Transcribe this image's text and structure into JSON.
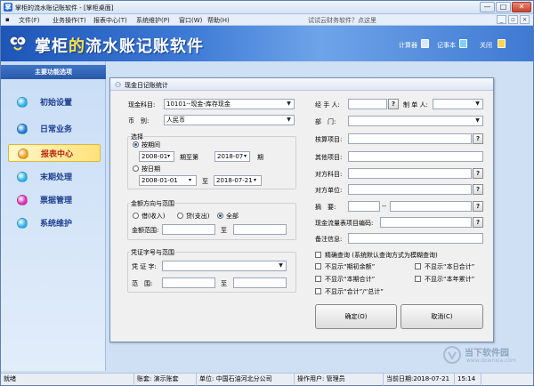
{
  "window": {
    "title": "掌柜的流水账记账软件 - [掌柜桌面]",
    "controls": [
      "—",
      "□",
      "✕"
    ]
  },
  "menu": {
    "items": [
      "文件(F)",
      "业务操作(T)",
      "报表中心(T)",
      "系统维护(P)",
      "窗口(W)",
      "帮助(H)"
    ],
    "promo": "试试云财务软件？点这里",
    "mdi_controls": [
      "_",
      "▫",
      "×"
    ]
  },
  "banner": {
    "logo_prefix": "掌柜",
    "logo_highlight": "的",
    "logo_suffix": "流水账记账软件",
    "tools": [
      "计算器",
      "记事本",
      "关闭"
    ]
  },
  "sidebar": {
    "title": "主要功能选项",
    "items": [
      {
        "label": "初始设置",
        "color": "#2bb1e8"
      },
      {
        "label": "日常业务",
        "color": "#1d7bd6"
      },
      {
        "label": "报表中心",
        "color": "#f4a01c"
      },
      {
        "label": "末期处理",
        "color": "#2bb1e8"
      },
      {
        "label": "票据管理",
        "color": "#d92fb0"
      },
      {
        "label": "系统维护",
        "color": "#2bb1e8"
      }
    ],
    "active_index": 2
  },
  "dialog": {
    "title": "现金日记账统计",
    "account_label": "现金科目:",
    "account_value": "10101--现金-库存现金",
    "currency_label": "币　别:",
    "currency_value": "人民币",
    "select_group_label": "选择",
    "by_period_label": "按期间",
    "period_from_date": "2008-01",
    "period_from_suffix": "期至第",
    "period_to_date": "2018-07",
    "period_to_suffix": "期",
    "by_date_label": "按日期",
    "date_from": "2008-01-01",
    "date_to_label": "至",
    "date_to": "2018-07-21",
    "amount_group_label": "金额方向与范围",
    "debit_label": "借(收入)",
    "credit_label": "贷(支出)",
    "all_label": "全部",
    "amount_range_label": "金额范围:",
    "amount_to_label": "至",
    "voucher_group_label": "凭证字号与范围",
    "voucher_word_label": "凭 证 字:",
    "voucher_range_label": "范　围:",
    "voucher_to_label": "至",
    "handler_label": "经 手 人:",
    "maker_label": "制 单 人:",
    "department_label": "部　门:",
    "checking_label": "核算项目:",
    "other_checking_label": "其他项目:",
    "opposite_account_label": "对方科目:",
    "opposite_unit_label": "对方单位:",
    "summary_label": "摘　要:",
    "summary_separator": "--",
    "cashflow_label": "现金流量表项目编码:",
    "notes_label": "备注信息:",
    "exact_query_label": "精确查询 (系统默认查询方式为模糊查询)",
    "options": [
      "不显示“期初余额”",
      "不显示“本日合计”",
      "不显示“本期合计”",
      "不显示“本年累计”",
      "不显示“合计”/“总计”"
    ],
    "ok_label": "确定(O)",
    "cancel_label": "取消(C)",
    "question_mark": "?"
  },
  "statusbar": {
    "ready": "就绪",
    "book_label": "账套:",
    "book_value": "演示账套",
    "unit_label": "单位:",
    "unit_value": "中国石油河北分公司",
    "operator_label": "操作用户:",
    "operator_value": "管理员",
    "date_label": "当前日期:",
    "date_value": "2018-07-21",
    "time_value": "15:14"
  },
  "watermark": {
    "title": "当下软件园",
    "url": "www.downxia.com"
  }
}
